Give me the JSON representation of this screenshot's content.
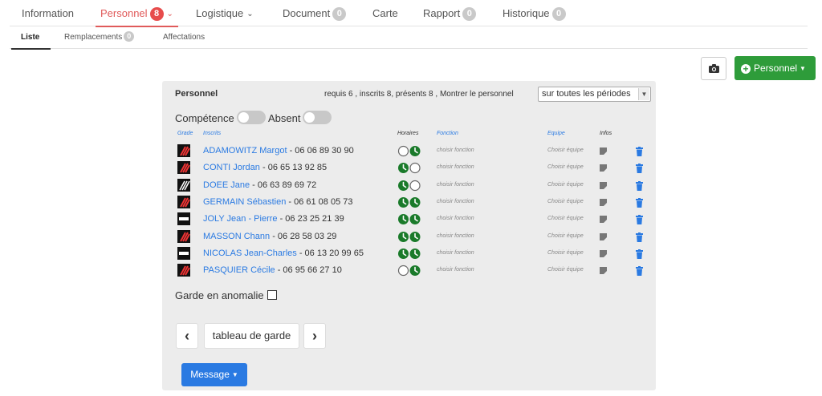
{
  "tabs": [
    {
      "label": "Information"
    },
    {
      "label": "Personnel",
      "badge": "8"
    },
    {
      "label": "Logistique"
    },
    {
      "label": "Document",
      "badge": "0"
    },
    {
      "label": "Carte"
    },
    {
      "label": "Rapport",
      "badge": "0"
    },
    {
      "label": "Historique",
      "badge": "0"
    }
  ],
  "subtabs": [
    {
      "label": "Liste"
    },
    {
      "label": "Remplacements",
      "badge": "0"
    },
    {
      "label": "Affectations"
    }
  ],
  "actions": {
    "personnel_label": "Personnel"
  },
  "panel": {
    "title": "Personnel",
    "summary": "requis 6 , inscrits 8, présents 8 , Montrer le personnel",
    "period_select": "sur toutes les périodes",
    "filter_competence": "Compétence",
    "filter_absent": "Absent",
    "headers": {
      "grade": "Grade",
      "inscrits": "Inscrits",
      "horaires": "Horaires",
      "fonction": "Fonction",
      "equipe": "Equipe",
      "infos": "Infos"
    },
    "rows": [
      {
        "name": "ADAMOWITZ Margot",
        "phone": " - 06 06 89 30 90",
        "fonction": "choisir fonction",
        "equipe": "Choisir équipe",
        "grade_icon": "grade-red-stripes",
        "clock1": "empty",
        "clock2": "filled"
      },
      {
        "name": "CONTI Jordan",
        "phone": " - 06 65 13 92 85",
        "fonction": "choisir fonction",
        "equipe": "Choisir équipe",
        "grade_icon": "grade-red-stripes",
        "clock1": "filled",
        "clock2": "empty"
      },
      {
        "name": "DOEE Jane",
        "phone": " - 06 63 89 69 72",
        "fonction": "choisir fonction",
        "equipe": "Choisir équipe",
        "grade_icon": "grade-white-stripes",
        "clock1": "filled",
        "clock2": "empty"
      },
      {
        "name": "GERMAIN Sébastien",
        "phone": " - 06 61 08 05 73",
        "fonction": "choisir fonction",
        "equipe": "Choisir équipe",
        "grade_icon": "grade-red-stripes",
        "clock1": "filled",
        "clock2": "filled"
      },
      {
        "name": "JOLY Jean - Pierre",
        "phone": " - 06 23 25 21 39",
        "fonction": "choisir fonction",
        "equipe": "Choisir équipe",
        "grade_icon": "grade-white-bar",
        "clock1": "filled",
        "clock2": "filled"
      },
      {
        "name": "MASSON Chann",
        "phone": " - 06 28 58 03 29",
        "fonction": "choisir fonction",
        "equipe": "Choisir équipe",
        "grade_icon": "grade-red-stripes",
        "clock1": "filled",
        "clock2": "filled"
      },
      {
        "name": "NICOLAS Jean-Charles",
        "phone": " - 06 13 20 99 65",
        "fonction": "choisir fonction",
        "equipe": "Choisir équipe",
        "grade_icon": "grade-white-bar",
        "clock1": "filled",
        "clock2": "filled"
      },
      {
        "name": "PASQUIER Cécile",
        "phone": " - 06 95 66 27 10",
        "fonction": "choisir fonction",
        "equipe": "Choisir équipe",
        "grade_icon": "grade-red-stripes",
        "clock1": "empty",
        "clock2": "filled"
      }
    ],
    "anomaly_label": "Garde en anomalie",
    "nav": {
      "prev": "‹",
      "middle": "tableau de garde",
      "next": "›"
    },
    "message_label": "Message"
  },
  "colors": {
    "accent_red": "#e05a5a",
    "green": "#2e9c3a",
    "blue": "#2a7ae2",
    "clock_green": "#1a7a2a"
  }
}
